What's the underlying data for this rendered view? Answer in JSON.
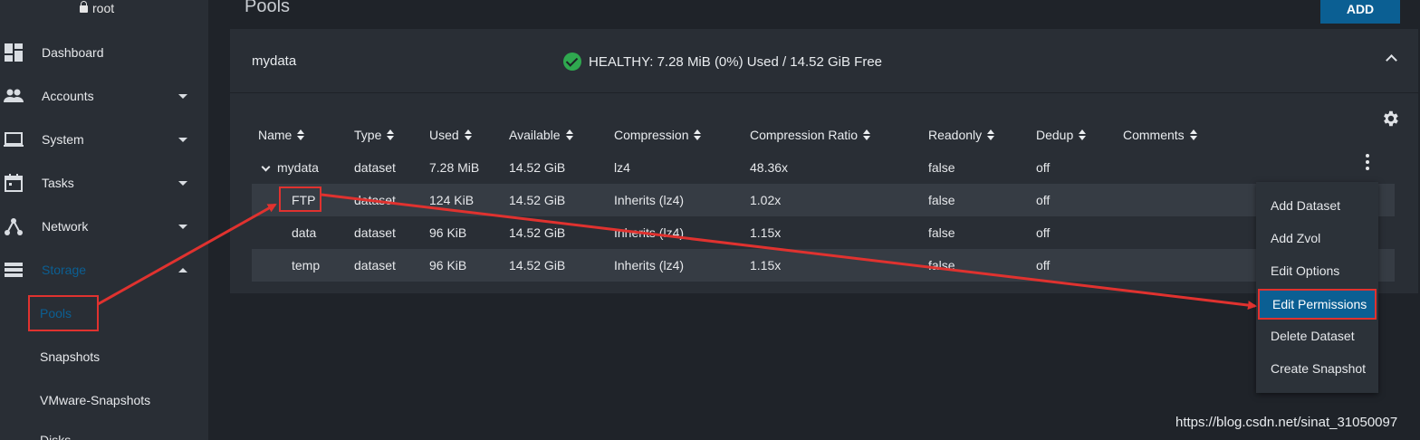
{
  "sidebar": {
    "user": "root",
    "items": [
      {
        "label": "Dashboard",
        "icon": "dashboard-icon"
      },
      {
        "label": "Accounts",
        "icon": "people-icon"
      },
      {
        "label": "System",
        "icon": "laptop-icon"
      },
      {
        "label": "Tasks",
        "icon": "calendar-icon"
      },
      {
        "label": "Network",
        "icon": "network-icon"
      },
      {
        "label": "Storage",
        "icon": "storage-icon"
      }
    ],
    "storage_sub": [
      "Pools",
      "Snapshots",
      "VMware-Snapshots",
      "Disks"
    ]
  },
  "page": {
    "title": "Pools",
    "add_label": "ADD"
  },
  "pool": {
    "name": "mydata",
    "status": "HEALTHY: 7.28 MiB (0%) Used / 14.52 GiB Free"
  },
  "table": {
    "columns": [
      "Name",
      "Type",
      "Used",
      "Available",
      "Compression",
      "Compression Ratio",
      "Readonly",
      "Dedup",
      "Comments"
    ],
    "rows": [
      {
        "name": "mydata",
        "type": "dataset",
        "used": "7.28 MiB",
        "available": "14.52 GiB",
        "compression": "lz4",
        "ratio": "48.36x",
        "readonly": "false",
        "dedup": "off"
      },
      {
        "name": "FTP",
        "type": "dataset",
        "used": "124 KiB",
        "available": "14.52 GiB",
        "compression": "Inherits (lz4)",
        "ratio": "1.02x",
        "readonly": "false",
        "dedup": "off"
      },
      {
        "name": "data",
        "type": "dataset",
        "used": "96 KiB",
        "available": "14.52 GiB",
        "compression": "Inherits (lz4)",
        "ratio": "1.15x",
        "readonly": "false",
        "dedup": "off"
      },
      {
        "name": "temp",
        "type": "dataset",
        "used": "96 KiB",
        "available": "14.52 GiB",
        "compression": "Inherits (lz4)",
        "ratio": "1.15x",
        "readonly": "false",
        "dedup": "off"
      }
    ]
  },
  "menu": {
    "items": [
      "Add Dataset",
      "Add Zvol",
      "Edit Options",
      "Edit Permissions",
      "Delete Dataset",
      "Create Snapshot"
    ]
  },
  "watermark": "https://blog.csdn.net/sinat_31050097",
  "colors": {
    "accent": "#0b5f93",
    "annotation": "#e0322f",
    "healthy": "#2fa84f"
  }
}
